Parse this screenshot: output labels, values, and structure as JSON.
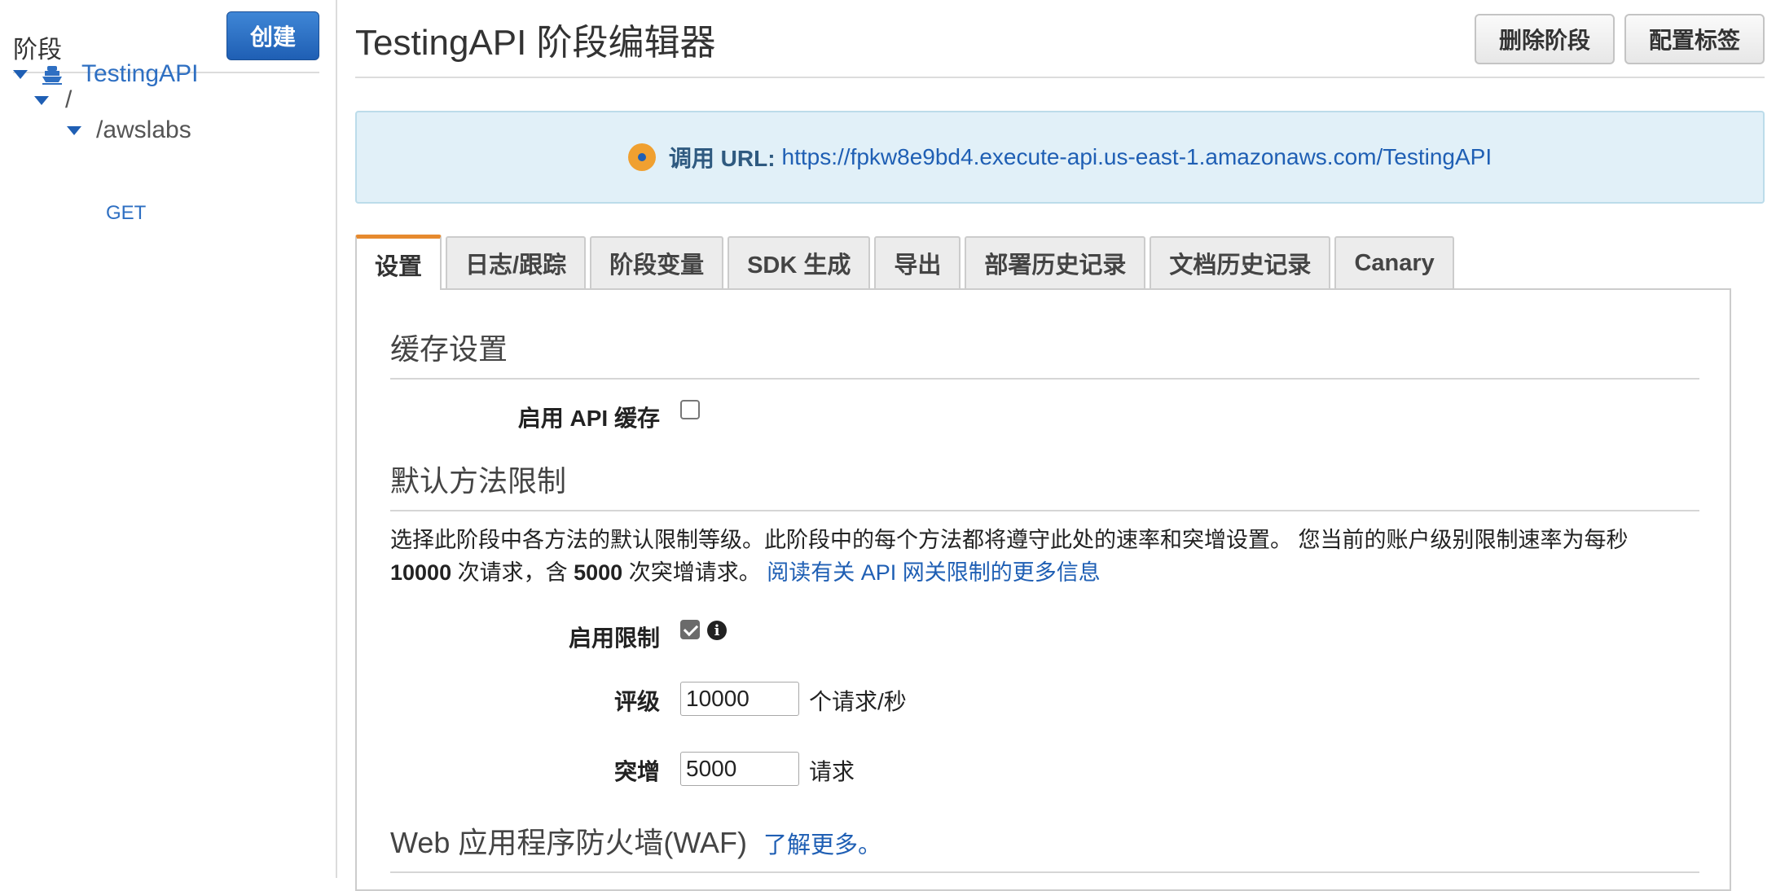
{
  "sidebar": {
    "title": "阶段",
    "create_label": "创建",
    "tree": {
      "api_name": "TestingAPI",
      "root_path": "/",
      "resource": "/awslabs",
      "method": "GET"
    }
  },
  "header": {
    "title": "TestingAPI 阶段编辑器",
    "delete_label": "删除阶段",
    "tags_label": "配置标签"
  },
  "invoke": {
    "label": "调用 URL:",
    "url": "https://fpkw8e9bd4.execute-api.us-east-1.amazonaws.com/TestingAPI"
  },
  "tabs": [
    {
      "label": "设置",
      "active": true
    },
    {
      "label": "日志/跟踪"
    },
    {
      "label": "阶段变量"
    },
    {
      "label": "SDK 生成"
    },
    {
      "label": "导出"
    },
    {
      "label": "部署历史记录"
    },
    {
      "label": "文档历史记录"
    },
    {
      "label": "Canary"
    }
  ],
  "cache": {
    "title": "缓存设置",
    "enable_label": "启用 API 缓存",
    "enabled": false
  },
  "throttle": {
    "title": "默认方法限制",
    "desc_part1": "选择此阶段中各方法的默认限制等级。此阶段中的每个方法都将遵守此处的速率和突增设置。 您当前的账户级别限制速率为每秒",
    "rate_limit": "10000",
    "desc_part2": "次请求，含",
    "burst_limit": "5000",
    "desc_part3": "次突增请求。",
    "learn_link": "阅读有关 API 网关限制的更多信息",
    "enable_label": "启用限制",
    "enabled": true,
    "rate_label": "评级",
    "rate_value": "10000",
    "rate_unit": "个请求/秒",
    "burst_label": "突增",
    "burst_value": "5000",
    "burst_unit": "请求"
  },
  "waf": {
    "title": "Web 应用程序防火墙(WAF)",
    "link": "了解更多。"
  },
  "icons": [
    "caret-down-icon",
    "api-icon",
    "info-dot-icon",
    "info-icon"
  ],
  "colors": {
    "primary": "#1f5fb4",
    "accent": "#e68a2e",
    "info_bg": "#e1f0f8"
  }
}
